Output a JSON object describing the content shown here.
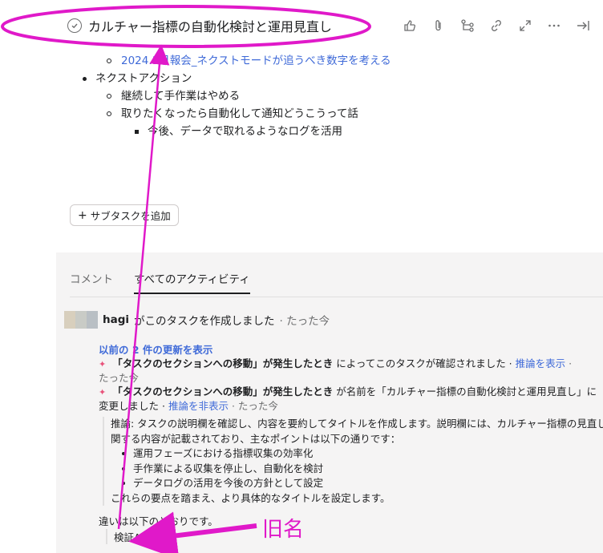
{
  "header": {
    "title": "カルチャー指標の自動化検討と運用見直し"
  },
  "description": {
    "report_link": "2024.1月報会_ネクストモードが追うべき数字を考える",
    "next_action": "ネクストアクション",
    "sub1": "継続して手作業はやめる",
    "sub2": "取りたくなったら自動化して通知どうこうって話",
    "subsub1": "今後、データで取れるようなログを活用"
  },
  "subtask_button": {
    "label": "サブタスクを追加"
  },
  "activity": {
    "tabs": [
      "コメント",
      "すべてのアクティビティ"
    ],
    "story": {
      "user": "hagi",
      "text": "がこのタスクを作成しました",
      "time": "· たった今"
    },
    "show_prev": "以前の 2 件の更新を表示",
    "rule1_bold": "「タスクのセクションへの移動」が発生したとき",
    "rule1_text": "によってこのタスクが確認されました ·",
    "rule1_link": "推論を表示",
    "rule1_time": "たった今",
    "rule2_bold": "「タスクのセクションへの移動」が発生したとき",
    "rule2_text": "が名前を「カルチャー指標の自動化検討と運用見直し」に",
    "rule2_text2": "変更しました ·",
    "rule2_link": "推論を非表示",
    "rule2_time": "· たった今",
    "reasoning_1": "推論: タスクの説明欄を確認し、内容を要約してタイトルを作成します。説明欄には、カルチャー指標の見直しに",
    "reasoning_2": "関する内容が記載されており、主なポイントは以下の通りです：",
    "points": [
      "運用フェーズにおける指標収集の効率化",
      "手作業による収集を停止し、自動化を検討",
      "データログの活用を今後の方針として設定"
    ],
    "reasoning_end": "これらの要点を踏まえ、より具体的なタイトルを設定します。",
    "diff_intro": "違いは以下のとおりです。",
    "old_name": "検証A"
  },
  "annotation": {
    "label": "旧名",
    "color": "#e019c9"
  }
}
